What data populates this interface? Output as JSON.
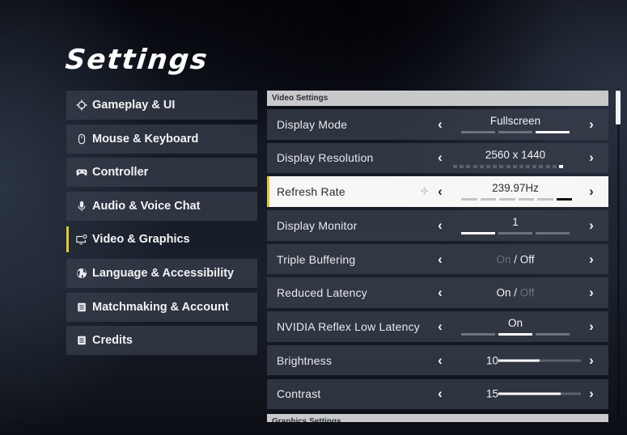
{
  "title": "Settings",
  "sidebar": {
    "items": [
      {
        "label": "Gameplay & UI",
        "icon": "crosshair-icon",
        "active": false
      },
      {
        "label": "Mouse & Keyboard",
        "icon": "mouse-icon",
        "active": false
      },
      {
        "label": "Controller",
        "icon": "gamepad-icon",
        "active": false
      },
      {
        "label": "Audio & Voice Chat",
        "icon": "microphone-icon",
        "active": false
      },
      {
        "label": "Video & Graphics",
        "icon": "monitor-gear-icon",
        "active": true
      },
      {
        "label": "Language & Accessibility",
        "icon": "globe-icon",
        "active": false
      },
      {
        "label": "Matchmaking & Account",
        "icon": "document-icon",
        "active": false
      },
      {
        "label": "Credits",
        "icon": "document-icon",
        "active": false
      }
    ]
  },
  "panel": {
    "section_video": "Video Settings",
    "section_graphics": "Graphics Settings",
    "arrow_left": "‹",
    "arrow_right": "›",
    "rows": {
      "display_mode": {
        "label": "Display Mode",
        "value": "Fullscreen",
        "option_count": 3,
        "selected_index": 2
      },
      "display_resolution": {
        "label": "Display Resolution",
        "value": "2560 x 1440",
        "option_count": 17,
        "selected_index": 16
      },
      "refresh_rate": {
        "label": "Refresh Rate",
        "value": "239.97Hz",
        "option_count": 6,
        "selected_index": 5,
        "focused": true
      },
      "display_monitor": {
        "label": "Display Monitor",
        "value": "1",
        "option_count": 3,
        "selected_index": 0
      },
      "triple_buffering": {
        "label": "Triple Buffering",
        "on_label": "On",
        "separator": "/",
        "off_label": "Off",
        "value": "Off"
      },
      "reduced_latency": {
        "label": "Reduced Latency",
        "on_label": "On",
        "separator": "/",
        "off_label": "Off",
        "value": "On"
      },
      "nvidia_reflex": {
        "label": "NVIDIA Reflex Low Latency",
        "value": "On",
        "option_count": 3,
        "selected_index": 1
      },
      "brightness": {
        "label": "Brightness",
        "value": "10",
        "min": 0,
        "max": 20
      },
      "contrast": {
        "label": "Contrast",
        "value": "15",
        "min": 0,
        "max": 20
      }
    }
  },
  "scrollbar": {
    "position_fraction": 0.0,
    "visible_fraction": 0.1
  },
  "colors": {
    "accent": "#e6c531",
    "focused_row_bg": "#f7f7f7",
    "section_header_bg": "#c8c9cb"
  }
}
